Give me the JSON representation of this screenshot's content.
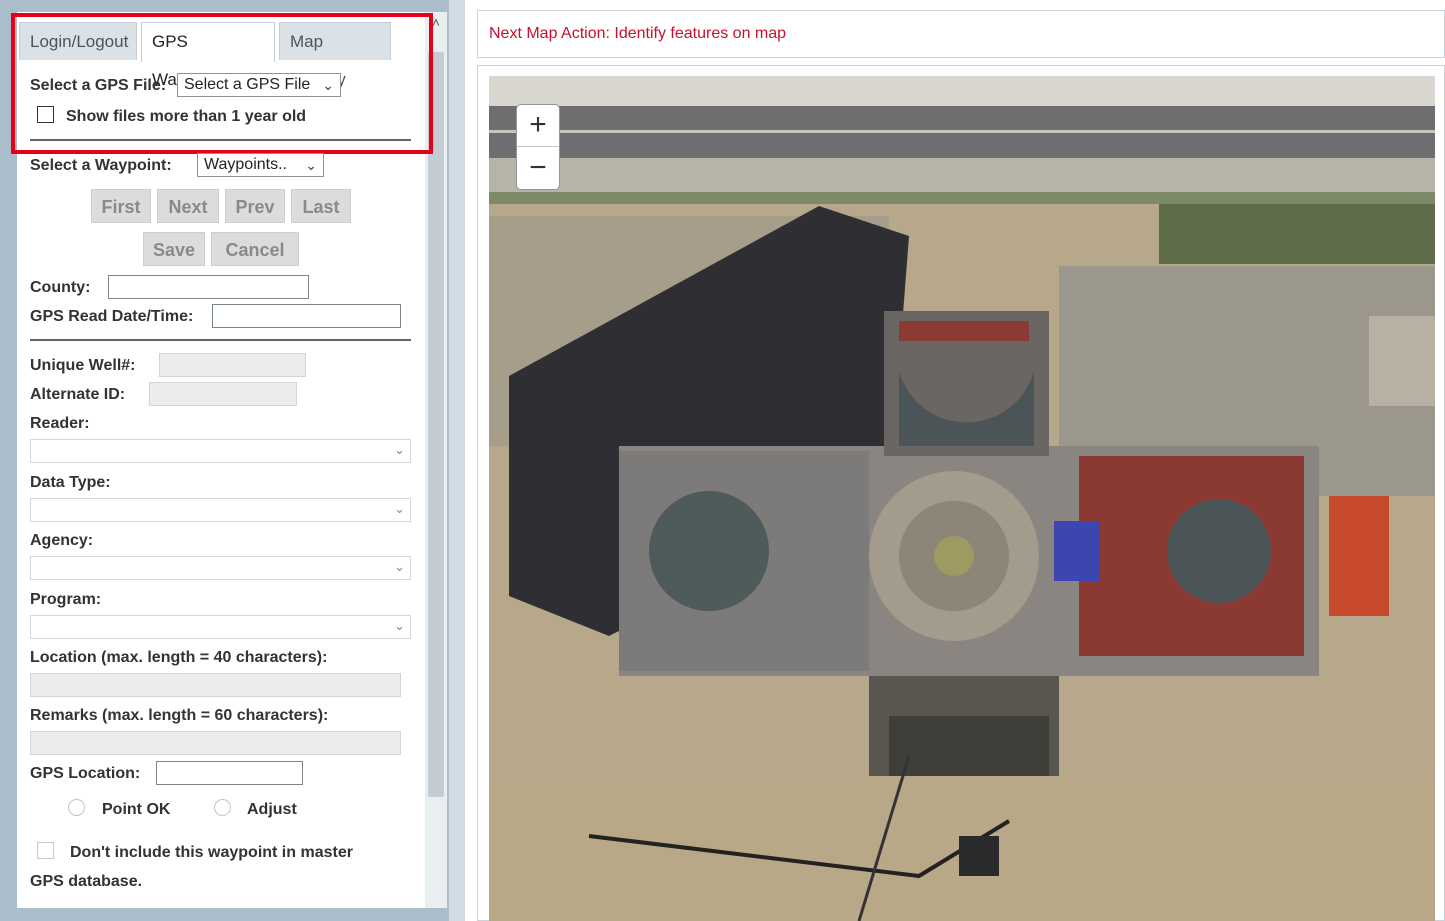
{
  "tabs": {
    "login": "Login/Logout",
    "gps": "GPS Waypoints",
    "map": "Map Display"
  },
  "gps_file": {
    "label": "Select a GPS File:",
    "value": "Select a GPS File",
    "show_old_label": "Show files more than 1 year old"
  },
  "waypoint": {
    "label": "Select a Waypoint:",
    "value": "Waypoints.."
  },
  "nav_buttons": {
    "first": "First",
    "next": "Next",
    "prev": "Prev",
    "last": "Last",
    "save": "Save",
    "cancel": "Cancel"
  },
  "fields": {
    "county": "County:",
    "gps_read": "GPS Read Date/Time:",
    "unique_well": "Unique Well#:",
    "alternate_id": "Alternate ID:",
    "reader": "Reader:",
    "data_type": "Data Type:",
    "agency": "Agency:",
    "program": "Program:",
    "location": "Location (max. length = 40 characters):",
    "remarks": "Remarks (max. length = 60 characters):",
    "gps_location": "GPS Location:"
  },
  "radios": {
    "point_ok": "Point OK",
    "adjust": "Adjust"
  },
  "exclude": {
    "line1": "Don't include this waypoint in master",
    "line2": "GPS database."
  },
  "map": {
    "action": "Next Map Action: Identify features on map",
    "zoom_in": "+",
    "zoom_out": "−"
  },
  "colors": {
    "highlight": "#e2001a",
    "action_text": "#c8102e",
    "frame": "#a9bdca"
  },
  "icons": {
    "scroll_up": "˄",
    "chevron": "⌄"
  }
}
